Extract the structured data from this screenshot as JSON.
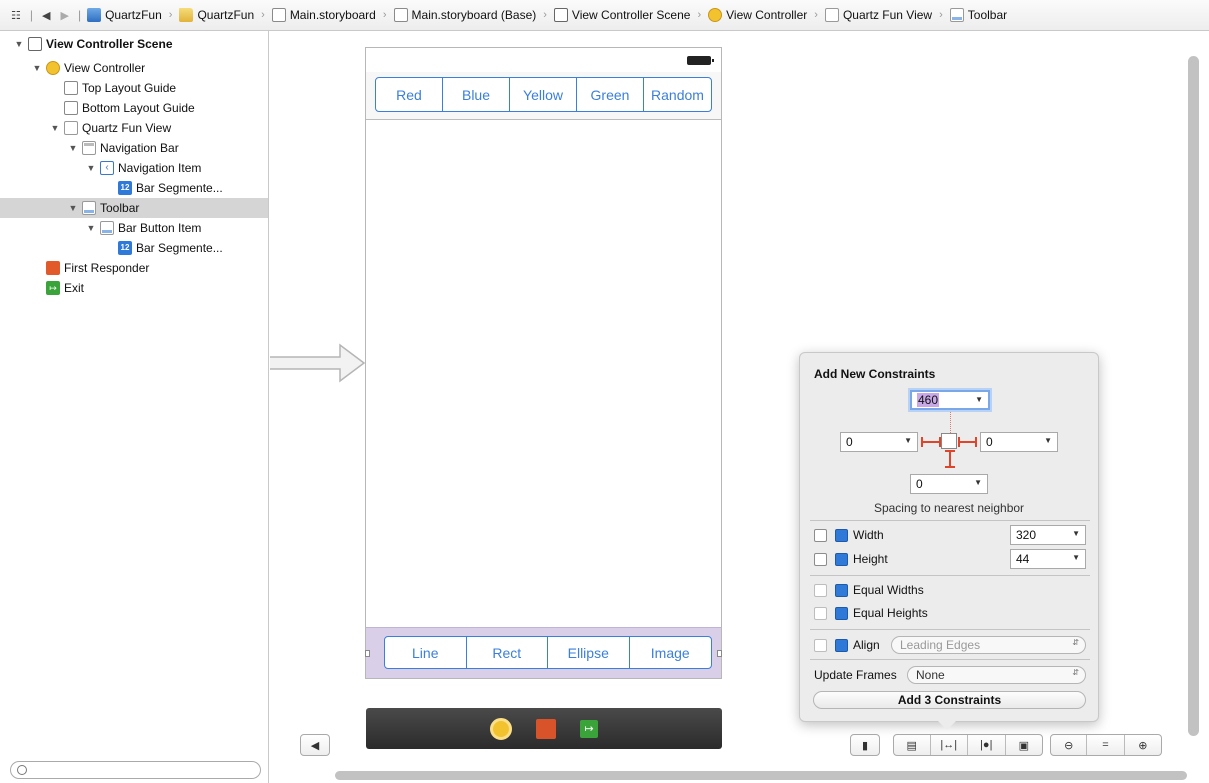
{
  "jumpbar": {
    "crumbs": [
      {
        "label": "QuartzFun",
        "icon": "project-icon"
      },
      {
        "label": "QuartzFun",
        "icon": "folder-icon"
      },
      {
        "label": "Main.storyboard",
        "icon": "storyboard-file-icon"
      },
      {
        "label": "Main.storyboard (Base)",
        "icon": "storyboard-file-icon"
      },
      {
        "label": "View Controller Scene",
        "icon": "scene-icon"
      },
      {
        "label": "View Controller",
        "icon": "view-controller-icon"
      },
      {
        "label": "Quartz Fun View",
        "icon": "view-icon"
      },
      {
        "label": "Toolbar",
        "icon": "toolbar-icon"
      }
    ]
  },
  "outline": {
    "items": [
      {
        "label": "View Controller Scene",
        "depth": 0,
        "expanded": true,
        "icon": "scene-icon"
      },
      {
        "label": "View Controller",
        "depth": 1,
        "expanded": true,
        "icon": "view-controller-icon"
      },
      {
        "label": "Top Layout Guide",
        "depth": 2,
        "expanded": null,
        "icon": "layout-guide-icon"
      },
      {
        "label": "Bottom Layout Guide",
        "depth": 2,
        "expanded": null,
        "icon": "layout-guide-icon"
      },
      {
        "label": "Quartz Fun View",
        "depth": 2,
        "expanded": true,
        "icon": "view-icon"
      },
      {
        "label": "Navigation Bar",
        "depth": 3,
        "expanded": true,
        "icon": "navigation-bar-icon"
      },
      {
        "label": "Navigation Item",
        "depth": 4,
        "expanded": true,
        "icon": "navigation-item-icon"
      },
      {
        "label": "Bar Segmente...",
        "depth": 5,
        "expanded": null,
        "icon": "segmented-control-icon"
      },
      {
        "label": "Toolbar",
        "depth": 3,
        "expanded": true,
        "icon": "toolbar-icon",
        "selected": true
      },
      {
        "label": "Bar Button Item",
        "depth": 4,
        "expanded": true,
        "icon": "bar-button-item-icon"
      },
      {
        "label": "Bar Segmente...",
        "depth": 5,
        "expanded": null,
        "icon": "segmented-control-icon"
      },
      {
        "label": "First Responder",
        "depth": 1,
        "expanded": null,
        "icon": "first-responder-icon"
      },
      {
        "label": "Exit",
        "depth": 1,
        "expanded": null,
        "icon": "exit-icon"
      }
    ]
  },
  "scene": {
    "top_segments": [
      "Red",
      "Blue",
      "Yellow",
      "Green",
      "Random"
    ],
    "bottom_segments": [
      "Line",
      "Rect",
      "Ellipse",
      "Image"
    ]
  },
  "popover": {
    "title": "Add New Constraints",
    "top_value": "460",
    "left_value": "0",
    "right_value": "0",
    "bottom_value": "0",
    "caption": "Spacing to nearest neighbor",
    "width_label": "Width",
    "width_value": "320",
    "height_label": "Height",
    "height_value": "44",
    "equal_widths_label": "Equal Widths",
    "equal_heights_label": "Equal Heights",
    "align_label": "Align",
    "align_value": "Leading Edges",
    "update_frames_label": "Update Frames",
    "update_frames_value": "None",
    "add_button": "Add 3 Constraints"
  },
  "colors": {
    "accent": "#3b7fdc",
    "toolbar_selected_tint": "#d9cfe8",
    "strut": "#e0442a"
  }
}
